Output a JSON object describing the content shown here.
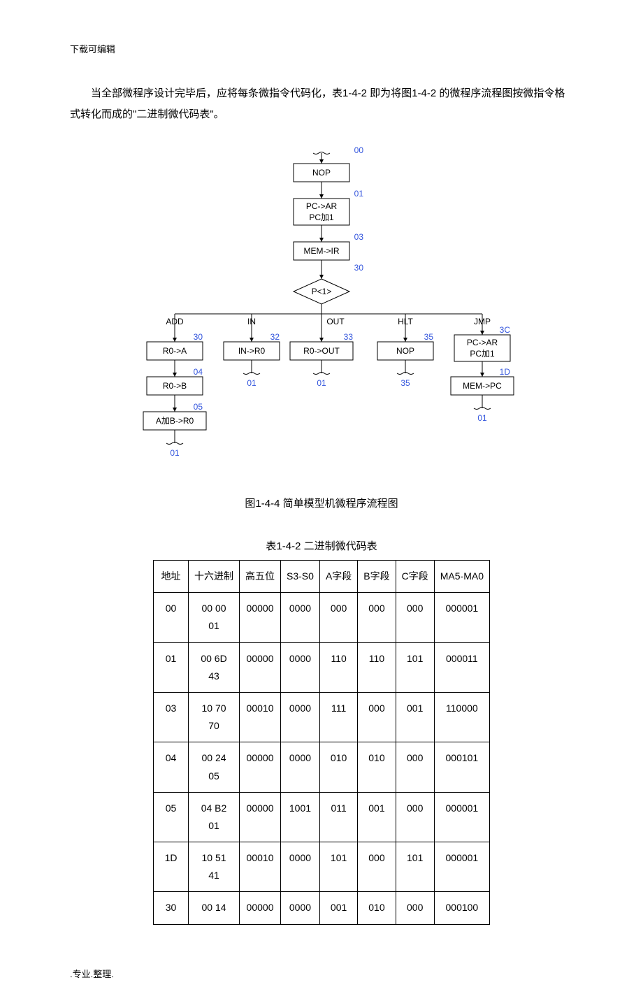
{
  "header_note": "下载可编辑",
  "body_text": "当全部微程序设计完毕后，应将每条微指令代码化，表1-4-2 即为将图1-4-2 的微程序流程图按微指令格式转化而成的\"二进制微代码表\"。",
  "chart_data": {
    "type": "diagram",
    "kind": "micro-program-flowchart",
    "nodes": [
      {
        "id": "n00",
        "label": "NOP",
        "addr": "00"
      },
      {
        "id": "n01",
        "label_line1": "PC->AR",
        "label_line2": "PC加1",
        "addr": "01"
      },
      {
        "id": "n03",
        "label": "MEM->IR",
        "addr": "03"
      },
      {
        "id": "p1",
        "label": "P<1>",
        "addr": "30",
        "shape": "diamond"
      },
      {
        "id": "add_head",
        "head": "ADD"
      },
      {
        "id": "in_head",
        "head": "IN"
      },
      {
        "id": "out_head",
        "head": "OUT"
      },
      {
        "id": "hlt_head",
        "head": "HLT"
      },
      {
        "id": "jmp_head",
        "head": "JMP"
      },
      {
        "id": "n30",
        "label": "R0->A",
        "addr": "30"
      },
      {
        "id": "n04",
        "label": "R0->B",
        "addr": "04"
      },
      {
        "id": "n05",
        "label": "A加B->R0",
        "addr": "05",
        "next": "01"
      },
      {
        "id": "n32",
        "label": "IN->R0",
        "addr": "32",
        "next": "01"
      },
      {
        "id": "n33",
        "label": "R0->OUT",
        "addr": "33",
        "next": "01"
      },
      {
        "id": "n35",
        "label": "NOP",
        "addr": "35",
        "next": "35"
      },
      {
        "id": "n3c",
        "label_line1": "PC->AR",
        "label_line2": "PC加1",
        "addr": "3C"
      },
      {
        "id": "n1d",
        "label": "MEM->PC",
        "addr": "1D",
        "next": "01"
      }
    ],
    "branches": [
      "ADD",
      "IN",
      "OUT",
      "HLT",
      "JMP"
    ]
  },
  "fig_caption": "图1-4-4 简单模型机微程序流程图",
  "table_caption": "表1-4-2 二进制微代码表",
  "table": {
    "headers": {
      "addr": "地址",
      "hex": "十六进制",
      "high5": "高五位",
      "s3s0": "S3-S0",
      "a": "A字段",
      "b": "B字段",
      "c": "C字段",
      "ma": "MA5-MA0"
    },
    "rows": [
      {
        "addr": "00",
        "hex": "00 00 01",
        "high5": "00000",
        "s3s0": "0000",
        "a": "000",
        "b": "000",
        "c": "000",
        "ma": "000001"
      },
      {
        "addr": "01",
        "hex": "00 6D 43",
        "high5": "00000",
        "s3s0": "0000",
        "a": "110",
        "b": "110",
        "c": "101",
        "ma": "000011"
      },
      {
        "addr": "03",
        "hex": "10 70 70",
        "high5": "00010",
        "s3s0": "0000",
        "a": "111",
        "b": "000",
        "c": "001",
        "ma": "110000"
      },
      {
        "addr": "04",
        "hex": "00 24 05",
        "high5": "00000",
        "s3s0": "0000",
        "a": "010",
        "b": "010",
        "c": "000",
        "ma": "000101"
      },
      {
        "addr": "05",
        "hex": "04 B2 01",
        "high5": "00000",
        "s3s0": "1001",
        "a": "011",
        "b": "001",
        "c": "000",
        "ma": "000001"
      },
      {
        "addr": "1D",
        "hex": "10 51 41",
        "high5": "00010",
        "s3s0": "0000",
        "a": "101",
        "b": "000",
        "c": "101",
        "ma": "000001"
      },
      {
        "addr": "30",
        "hex": "00 14",
        "high5": "00000",
        "s3s0": "0000",
        "a": "001",
        "b": "010",
        "c": "000",
        "ma": "000100"
      }
    ]
  },
  "footer_note": ".专业.整理."
}
